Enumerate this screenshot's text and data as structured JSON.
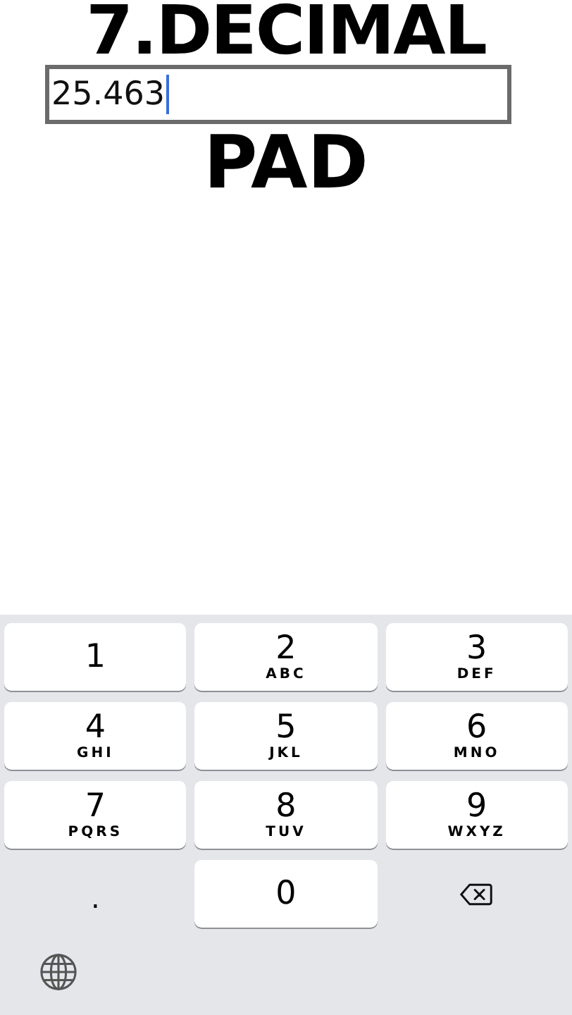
{
  "caption": {
    "lines": [
      "7.DECIMAL",
      "PAD"
    ]
  },
  "field": {
    "value": "25.463",
    "focused": true
  },
  "keyboard": {
    "keys": [
      {
        "kind": "digit",
        "digit": "1"
      },
      {
        "kind": "digit",
        "digit": "2",
        "letters": "ABC"
      },
      {
        "kind": "digit",
        "digit": "3",
        "letters": "DEF"
      },
      {
        "kind": "digit",
        "digit": "4",
        "letters": "GHI"
      },
      {
        "kind": "digit",
        "digit": "5",
        "letters": "JKL"
      },
      {
        "kind": "digit",
        "digit": "6",
        "letters": "MNO"
      },
      {
        "kind": "digit",
        "digit": "7",
        "letters": "PQRS"
      },
      {
        "kind": "digit",
        "digit": "8",
        "letters": "TUV"
      },
      {
        "kind": "digit",
        "digit": "9",
        "letters": "WXYZ"
      },
      {
        "kind": "decimal",
        "digit": "."
      },
      {
        "kind": "digit",
        "digit": "0"
      },
      {
        "kind": "delete"
      }
    ]
  }
}
